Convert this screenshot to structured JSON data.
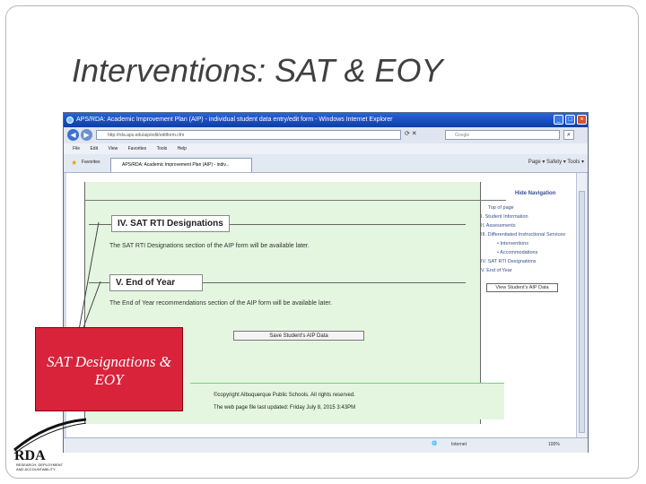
{
  "slide": {
    "title": "Interventions: SAT & EOY",
    "callout": "SAT Designations & EOY"
  },
  "browser": {
    "title": "APS/RDA: Academic Improvement Plan (AIP) - individual student data entry/edit form - Windows Internet Explorer",
    "address": "http://rda.aps.edu/aip/edit/editform.cfm",
    "search_placeholder": "Google",
    "menu": [
      "File",
      "Edit",
      "View",
      "Favorites",
      "Tools",
      "Help"
    ],
    "favorites_label": "Favorites",
    "tab_label": "APS/RDA: Academic Improvement Plan (AIP) - indiv...",
    "tools": "Page ▾  Safety ▾  Tools ▾",
    "status_zone": "Internet",
    "zoom": "100%"
  },
  "page": {
    "section4_title": "IV. SAT RTI Designations",
    "section4_text": "The SAT RTI Designations section of the AIP form will be available later.",
    "section5_title": "V. End of Year",
    "section5_text": "The End of Year recommendations section of the AIP form will be available later.",
    "save_button": "Save Student's AIP Data",
    "copyright": "©copyright Albuquerque Public Schools. All rights reserved.",
    "last_updated": "The web page file last updated: Friday July 8, 2015 3:43PM",
    "hide_navigation": "Hide Navigation",
    "nav": [
      "Top of page",
      "I. Student Information",
      "II. Assessments",
      "III. Differentiated Instructional Services",
      "• Interventions",
      "• Accommodations",
      "IV. SAT RTI Designations",
      "V. End of Year"
    ],
    "view_button": "View Student's AIP Data"
  },
  "logo": {
    "name": "RDA",
    "line1": "RESEARCH, DEPLOYMENT",
    "line2": "AND ACCOUNTABILITY"
  }
}
